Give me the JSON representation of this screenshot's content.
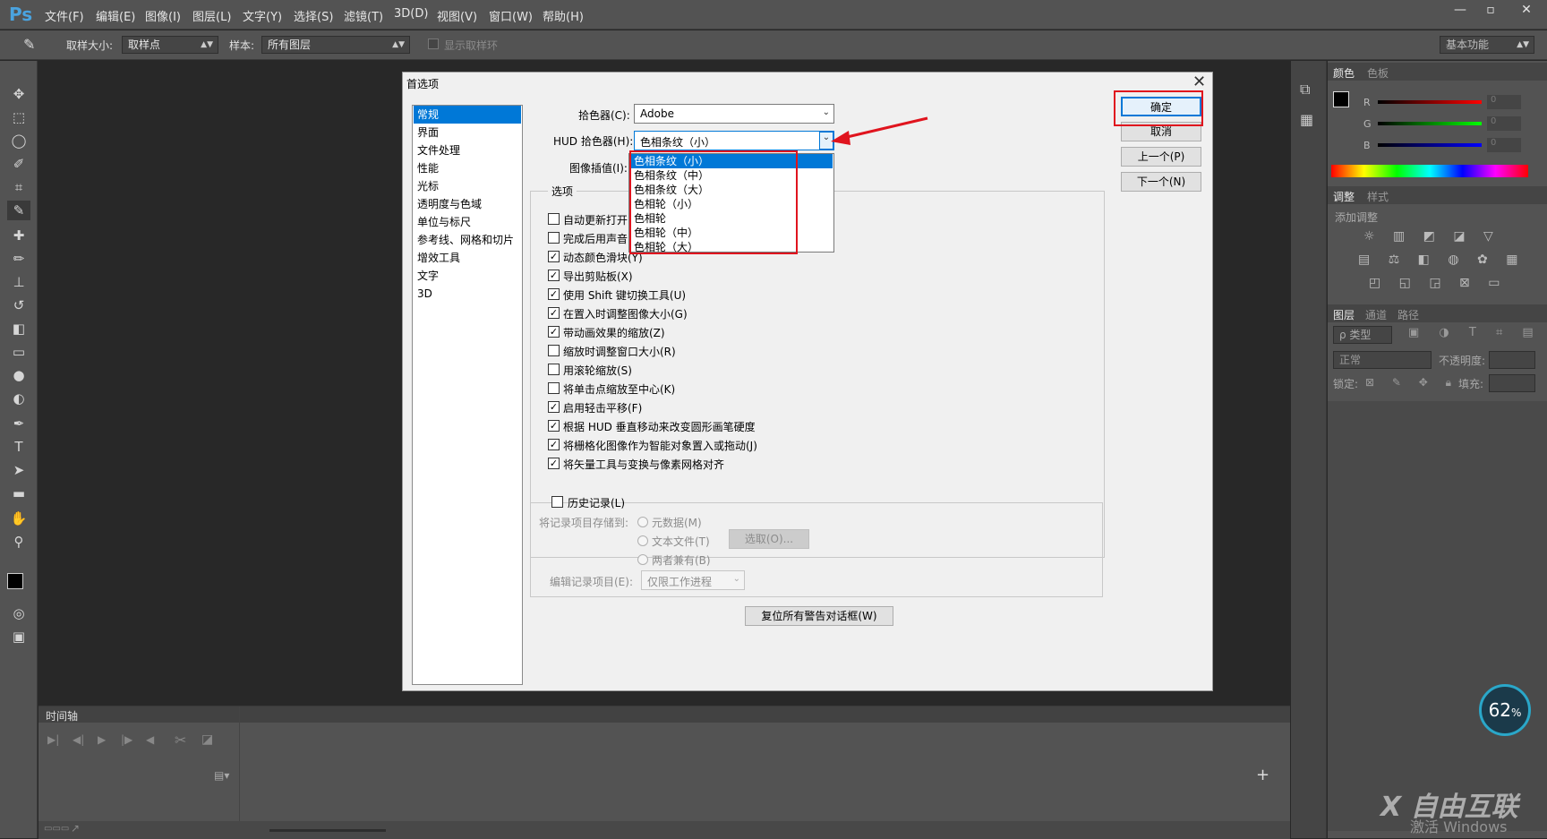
{
  "app": {
    "logo": "Ps",
    "menu": [
      "文件(F)",
      "编辑(E)",
      "图像(I)",
      "图层(L)",
      "文字(Y)",
      "选择(S)",
      "滤镜(T)",
      "3D(D)",
      "视图(V)",
      "窗口(W)",
      "帮助(H)"
    ],
    "window_buttons": [
      "—",
      "▫",
      "✕"
    ]
  },
  "options_bar": {
    "sample_size_label": "取样大小:",
    "sample_size_value": "取样点",
    "sample_label": "样本:",
    "sample_value": "所有图层",
    "show_ring_label": "显示取样环",
    "workspace": "基本功能"
  },
  "right_panel": {
    "color_tabs": [
      "颜色",
      "色板"
    ],
    "rgb_labels": [
      "R",
      "G",
      "B"
    ],
    "rgb_values": [
      "0",
      "0",
      "0"
    ],
    "adjust_tabs": [
      "调整",
      "样式"
    ],
    "add_adjustment": "添加调整",
    "layer_tabs": [
      "图层",
      "通道",
      "路径"
    ],
    "kind_label": "ρ 类型",
    "blend_mode": "正常",
    "opacity_label": "不透明度:",
    "lock_label": "锁定:",
    "fill_label": "填充:"
  },
  "timeline": {
    "title": "时间轴"
  },
  "dialog": {
    "title": "首选项",
    "categories": [
      "常规",
      "界面",
      "文件处理",
      "性能",
      "光标",
      "透明度与色域",
      "单位与标尺",
      "参考线、网格和切片",
      "增效工具",
      "文字",
      "3D"
    ],
    "selected_category": "常规",
    "color_picker_label": "拾色器(C):",
    "color_picker_value": "Adobe",
    "hud_picker_label": "HUD 拾色器(H):",
    "hud_picker_value": "色相条纹（小）",
    "interp_label": "图像插值(I):",
    "options_title": "选项",
    "options": [
      {
        "label": "自动更新打开的",
        "checked": false
      },
      {
        "label": "完成后用声音",
        "checked": false
      },
      {
        "label": "动态颜色滑块(Y)",
        "checked": true
      },
      {
        "label": "导出剪贴板(X)",
        "checked": true
      },
      {
        "label": "使用 Shift 键切换工具(U)",
        "checked": true
      },
      {
        "label": "在置入时调整图像大小(G)",
        "checked": true
      },
      {
        "label": "带动画效果的缩放(Z)",
        "checked": true
      },
      {
        "label": "缩放时调整窗口大小(R)",
        "checked": false
      },
      {
        "label": "用滚轮缩放(S)",
        "checked": false
      },
      {
        "label": "将单击点缩放至中心(K)",
        "checked": false
      },
      {
        "label": "启用轻击平移(F)",
        "checked": true
      },
      {
        "label": "根据 HUD 垂直移动来改变圆形画笔硬度",
        "checked": true
      },
      {
        "label": "将栅格化图像作为智能对象置入或拖动(J)",
        "checked": true
      },
      {
        "label": "将矢量工具与变换与像素网格对齐",
        "checked": true
      }
    ],
    "history_label": "历史记录(L)",
    "save_to_label": "将记录项目存储到:",
    "radio_metadata": "元数据(M)",
    "radio_textfile": "文本文件(T)",
    "radio_both": "两者兼有(B)",
    "choose_button": "选取(O)...",
    "edit_log_label": "编辑记录项目(E):",
    "edit_log_value": "仅限工作进程",
    "reset_warnings_button": "复位所有警告对话框(W)",
    "ok_button": "确定",
    "cancel_button": "取消",
    "prev_button": "上一个(P)",
    "next_button": "下一个(N)",
    "dropdown_options": [
      "色相条纹（小）",
      "色相条纹（中）",
      "色相条纹（大）",
      "色相轮（小）",
      "色相轮",
      "色相轮（中）",
      "色相轮（大）"
    ]
  },
  "overlay": {
    "badge_value": "62",
    "badge_unit": "%",
    "watermark": "X 自由互联",
    "watermark_sub": "激活 Windows"
  },
  "colors": {
    "ps_panel": "#535353",
    "canvas": "#282828",
    "dialog_bg": "#f0f0f0",
    "selection": "#0078d7",
    "annotation_red": "#e0141e"
  }
}
